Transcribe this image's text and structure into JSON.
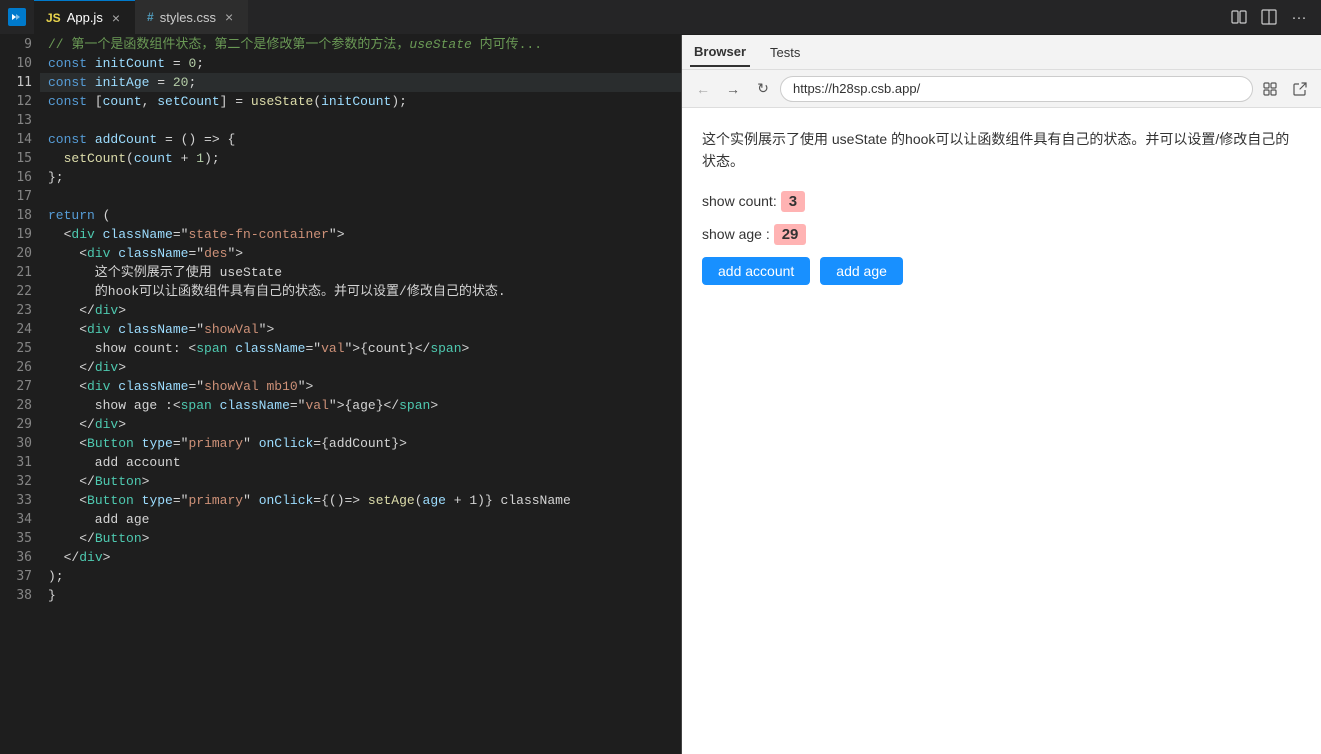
{
  "tabBar": {
    "tabs": [
      {
        "id": "app-js",
        "icon": "JS",
        "iconType": "js",
        "label": "App.js",
        "active": true
      },
      {
        "id": "styles-css",
        "icon": "#",
        "iconType": "css",
        "label": "styles.css",
        "active": false
      }
    ],
    "rightIcons": [
      "split-editor",
      "layout-icon",
      "more-icon"
    ]
  },
  "editor": {
    "lines": [
      {
        "num": 9,
        "tokens": [
          {
            "t": "comment",
            "v": "// 第一个是函数组件状态，第二个是修改第一个参数的方法，useState 内可传..."
          }
        ]
      },
      {
        "num": 10,
        "tokens": [
          {
            "t": "keyword",
            "v": "const "
          },
          {
            "t": "var",
            "v": "initCount"
          },
          {
            "t": "text",
            "v": " = "
          },
          {
            "t": "number",
            "v": "0"
          },
          {
            "t": "text",
            "v": ";"
          }
        ]
      },
      {
        "num": 11,
        "tokens": [
          {
            "t": "keyword",
            "v": "const "
          },
          {
            "t": "var",
            "v": "initAge"
          },
          {
            "t": "text",
            "v": " = "
          },
          {
            "t": "number",
            "v": "20"
          },
          {
            "t": "text",
            "v": ";"
          }
        ],
        "highlighted": true
      },
      {
        "num": 12,
        "tokens": [
          {
            "t": "keyword",
            "v": "const "
          },
          {
            "t": "text",
            "v": "["
          },
          {
            "t": "var",
            "v": "count"
          },
          {
            "t": "text",
            "v": ", "
          },
          {
            "t": "var",
            "v": "setCount"
          },
          {
            "t": "text",
            "v": "] = "
          },
          {
            "t": "func",
            "v": "useState"
          },
          {
            "t": "text",
            "v": "("
          },
          {
            "t": "var",
            "v": "initCount"
          },
          {
            "t": "text",
            "v": ");"
          }
        ]
      },
      {
        "num": 13,
        "tokens": []
      },
      {
        "num": 14,
        "tokens": [
          {
            "t": "keyword",
            "v": "const "
          },
          {
            "t": "var",
            "v": "addCount"
          },
          {
            "t": "text",
            "v": " = () => {"
          }
        ]
      },
      {
        "num": 15,
        "tokens": [
          {
            "t": "text",
            "v": "  "
          },
          {
            "t": "func",
            "v": "setCount"
          },
          {
            "t": "text",
            "v": "("
          },
          {
            "t": "var",
            "v": "count"
          },
          {
            "t": "text",
            "v": " + "
          },
          {
            "t": "number",
            "v": "1"
          },
          {
            "t": "text",
            "v": ");"
          }
        ]
      },
      {
        "num": 16,
        "tokens": [
          {
            "t": "text",
            "v": "};"
          }
        ]
      },
      {
        "num": 17,
        "tokens": []
      },
      {
        "num": 18,
        "tokens": [
          {
            "t": "keyword",
            "v": "return"
          },
          {
            "t": "text",
            "v": " ("
          }
        ]
      },
      {
        "num": 19,
        "tokens": [
          {
            "t": "text",
            "v": "  <"
          },
          {
            "t": "tag",
            "v": "div"
          },
          {
            "t": "text",
            "v": " "
          },
          {
            "t": "attr",
            "v": "className"
          },
          {
            "t": "text",
            "v": "=\""
          },
          {
            "t": "string",
            "v": "state-fn-container"
          },
          {
            "t": "text",
            "v": "\">"
          }
        ]
      },
      {
        "num": 20,
        "tokens": [
          {
            "t": "text",
            "v": "    <"
          },
          {
            "t": "tag",
            "v": "div"
          },
          {
            "t": "text",
            "v": " "
          },
          {
            "t": "attr",
            "v": "className"
          },
          {
            "t": "text",
            "v": "=\""
          },
          {
            "t": "string",
            "v": "des"
          },
          {
            "t": "text",
            "v": "\">"
          }
        ]
      },
      {
        "num": 21,
        "tokens": [
          {
            "t": "text",
            "v": "      这个实例展示了使用 useState"
          }
        ]
      },
      {
        "num": 22,
        "tokens": [
          {
            "t": "text",
            "v": "      的hook可以让函数组件具有自己的状态。并可以设置/修改自己的状态."
          }
        ]
      },
      {
        "num": 23,
        "tokens": [
          {
            "t": "text",
            "v": "    </"
          },
          {
            "t": "tag",
            "v": "div"
          },
          {
            "t": "text",
            "v": ">"
          }
        ]
      },
      {
        "num": 24,
        "tokens": [
          {
            "t": "text",
            "v": "    <"
          },
          {
            "t": "tag",
            "v": "div"
          },
          {
            "t": "text",
            "v": " "
          },
          {
            "t": "attr",
            "v": "className"
          },
          {
            "t": "text",
            "v": "=\""
          },
          {
            "t": "string",
            "v": "showVal"
          },
          {
            "t": "text",
            "v": "\">"
          }
        ]
      },
      {
        "num": 25,
        "tokens": [
          {
            "t": "text",
            "v": "      show count: <"
          },
          {
            "t": "tag",
            "v": "span"
          },
          {
            "t": "text",
            "v": " "
          },
          {
            "t": "attr",
            "v": "className"
          },
          {
            "t": "text",
            "v": "=\""
          },
          {
            "t": "string",
            "v": "val"
          },
          {
            "t": "text",
            "v": "\">{count}</"
          },
          {
            "t": "tag",
            "v": "span"
          },
          {
            "t": "text",
            "v": ">"
          }
        ]
      },
      {
        "num": 26,
        "tokens": [
          {
            "t": "text",
            "v": "    </"
          },
          {
            "t": "tag",
            "v": "div"
          },
          {
            "t": "text",
            "v": ">"
          }
        ]
      },
      {
        "num": 27,
        "tokens": [
          {
            "t": "text",
            "v": "    <"
          },
          {
            "t": "tag",
            "v": "div"
          },
          {
            "t": "text",
            "v": " "
          },
          {
            "t": "attr",
            "v": "className"
          },
          {
            "t": "text",
            "v": "=\""
          },
          {
            "t": "string",
            "v": "showVal mb10"
          },
          {
            "t": "text",
            "v": "\">"
          }
        ]
      },
      {
        "num": 28,
        "tokens": [
          {
            "t": "text",
            "v": "      show age :<"
          },
          {
            "t": "tag",
            "v": "span"
          },
          {
            "t": "text",
            "v": " "
          },
          {
            "t": "attr",
            "v": "className"
          },
          {
            "t": "text",
            "v": "=\""
          },
          {
            "t": "string",
            "v": "val"
          },
          {
            "t": "text",
            "v": "\">{age}</"
          },
          {
            "t": "tag",
            "v": "span"
          },
          {
            "t": "text",
            "v": ">"
          }
        ]
      },
      {
        "num": 29,
        "tokens": [
          {
            "t": "text",
            "v": "    </"
          },
          {
            "t": "tag",
            "v": "div"
          },
          {
            "t": "text",
            "v": ">"
          }
        ]
      },
      {
        "num": 30,
        "tokens": [
          {
            "t": "text",
            "v": "    <"
          },
          {
            "t": "component",
            "v": "Button"
          },
          {
            "t": "text",
            "v": " "
          },
          {
            "t": "attr",
            "v": "type"
          },
          {
            "t": "text",
            "v": "=\""
          },
          {
            "t": "string",
            "v": "primary"
          },
          {
            "t": "text",
            "v": "\" "
          },
          {
            "t": "attr",
            "v": "onClick"
          },
          {
            "t": "text",
            "v": "={addCount}>"
          }
        ]
      },
      {
        "num": 31,
        "tokens": [
          {
            "t": "text",
            "v": "      add account"
          }
        ]
      },
      {
        "num": 32,
        "tokens": [
          {
            "t": "text",
            "v": "    </"
          },
          {
            "t": "component",
            "v": "Button"
          },
          {
            "t": "text",
            "v": ">"
          }
        ]
      },
      {
        "num": 33,
        "tokens": [
          {
            "t": "text",
            "v": "    <"
          },
          {
            "t": "component",
            "v": "Button"
          },
          {
            "t": "text",
            "v": " "
          },
          {
            "t": "attr",
            "v": "type"
          },
          {
            "t": "text",
            "v": "=\""
          },
          {
            "t": "string",
            "v": "primary"
          },
          {
            "t": "text",
            "v": "\" "
          },
          {
            "t": "attr",
            "v": "onClick"
          },
          {
            "t": "text",
            "v": "={()=> "
          },
          {
            "t": "func",
            "v": "setAge"
          },
          {
            "t": "text",
            "v": "("
          },
          {
            "t": "var",
            "v": "age"
          },
          {
            "t": "text",
            "v": " + 1)} className"
          }
        ]
      },
      {
        "num": 34,
        "tokens": [
          {
            "t": "text",
            "v": "      add age"
          }
        ]
      },
      {
        "num": 35,
        "tokens": [
          {
            "t": "text",
            "v": "    </"
          },
          {
            "t": "component",
            "v": "Button"
          },
          {
            "t": "text",
            "v": ">"
          }
        ]
      },
      {
        "num": 36,
        "tokens": [
          {
            "t": "text",
            "v": "  </"
          },
          {
            "t": "tag",
            "v": "div"
          },
          {
            "t": "text",
            "v": ">"
          }
        ]
      },
      {
        "num": 37,
        "tokens": [
          {
            "t": "text",
            "v": ");"
          }
        ]
      },
      {
        "num": 38,
        "tokens": [
          {
            "t": "text",
            "v": "}"
          }
        ]
      }
    ]
  },
  "browser": {
    "tabs": [
      {
        "id": "browser",
        "label": "Browser",
        "active": true
      },
      {
        "id": "tests",
        "label": "Tests",
        "active": false
      }
    ],
    "url": "https://h28sp.csb.app/",
    "description": "这个实例展示了使用 useState 的hook可以让函数组件具有自己的状态。并可以设置/修改自己的状态。",
    "showCount": {
      "label": "show count:",
      "value": "3"
    },
    "showAge": {
      "label": "show age :",
      "value": "29"
    },
    "buttons": [
      {
        "id": "add-account",
        "label": "add account"
      },
      {
        "id": "add-age",
        "label": "add age"
      }
    ]
  }
}
